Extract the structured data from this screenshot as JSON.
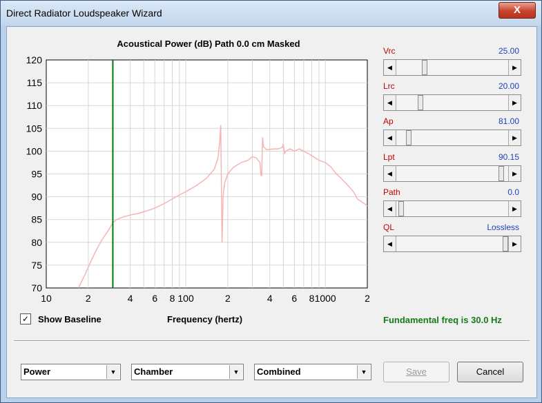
{
  "window": {
    "title": "Direct Radiator Loudspeaker Wizard",
    "close_label": "X"
  },
  "plot": {
    "header": "Acoustical Power (dB)   Path 0.0 cm   Masked",
    "x_axis_label": "Frequency (hertz)",
    "y_tick_labels": [
      "120",
      "115",
      "110",
      "105",
      "100",
      "95",
      "90",
      "85",
      "80",
      "75",
      "70"
    ],
    "x_tick_labels": [
      "10",
      "2",
      "4",
      "6",
      "8",
      "100",
      "2",
      "4",
      "6",
      "8",
      "1000",
      "2"
    ],
    "fundamental_marker_color": "#007a00",
    "curve_color": "#f4b4b4"
  },
  "chart_data": {
    "type": "line",
    "xlabel": "Frequency (hertz)",
    "ylabel": "Acoustical Power (dB)",
    "x_scale": "log",
    "xlim": [
      10,
      2000
    ],
    "ylim": [
      70,
      120
    ],
    "grid": true,
    "vertical_marker_x": 30,
    "series": [
      {
        "x": [
          17,
          19,
          21,
          23,
          25,
          27,
          29,
          30,
          32,
          35,
          40,
          45,
          50,
          55,
          60,
          70,
          80,
          90,
          100,
          120,
          140,
          160,
          170,
          175,
          178,
          180,
          182,
          185,
          190,
          200,
          220,
          250,
          280,
          300,
          320,
          340,
          345,
          350,
          355,
          360,
          380,
          400,
          430,
          460,
          490,
          500,
          510,
          520,
          560,
          600,
          650,
          700,
          750,
          800,
          900,
          1000,
          1100,
          1200,
          1300,
          1400,
          1500,
          1600,
          1700,
          1800,
          1900,
          2000
        ],
        "y": [
          70,
          73,
          76,
          78.5,
          80.5,
          82,
          83.5,
          84.3,
          85,
          85.5,
          86,
          86.3,
          86.7,
          87.1,
          87.5,
          88.5,
          89.5,
          90.4,
          91.1,
          92.5,
          94,
          96,
          98.5,
          102,
          105.7,
          92,
          80,
          90,
          93,
          95,
          96.5,
          97.5,
          98,
          98.8,
          98.5,
          97.5,
          95,
          94.5,
          103,
          101,
          100.3,
          100.4,
          100.5,
          100.5,
          100.8,
          101.5,
          99.5,
          100,
          100.5,
          100,
          100.5,
          100,
          99.5,
          99,
          98,
          97.5,
          96.5,
          95,
          94,
          93,
          92,
          91,
          89.5,
          89,
          88.5,
          88
        ]
      }
    ]
  },
  "checkbox": {
    "label": "Show Baseline",
    "checked_mark": "✓"
  },
  "status": {
    "text": "Fundamental freq is 30.0 Hz",
    "color": "#157a15"
  },
  "sliders": [
    {
      "name": "Vrc",
      "value": "25.00",
      "position": 0.24
    },
    {
      "name": "Lrc",
      "value": "20.00",
      "position": 0.2
    },
    {
      "name": "Ap",
      "value": "81.00",
      "position": 0.09
    },
    {
      "name": "Lpt",
      "value": "90.15",
      "position": 0.96
    },
    {
      "name": "Path",
      "value": "0.0",
      "position": 0.02
    },
    {
      "name": "QL",
      "value": "Lossless",
      "position": 1.0
    }
  ],
  "dropdowns": [
    {
      "name": "view",
      "selected": "Power"
    },
    {
      "name": "environment",
      "selected": "Chamber"
    },
    {
      "name": "mode",
      "selected": "Combined"
    }
  ],
  "buttons": {
    "save": "Save",
    "cancel": "Cancel"
  }
}
